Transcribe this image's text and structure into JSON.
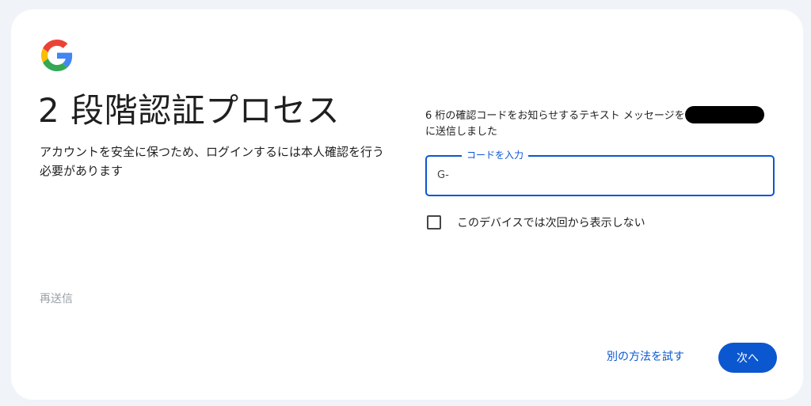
{
  "brand": {
    "logo_icon": "google-g-icon",
    "colors": {
      "blue": "#4285F4",
      "red": "#EA4335",
      "yellow": "#FBBC05",
      "green": "#34A853"
    }
  },
  "header": {
    "title": "2 段階認証プロセス",
    "subtitle": "アカウントを安全に保つため、ログインするには本人確認を行う必要があります"
  },
  "links": {
    "resend": "再送信",
    "try_another": "別の方法を試す"
  },
  "verification": {
    "message_before": "6 桁の確認コードをお知らせするテキスト メッセージを",
    "message_after": "に送信しました",
    "code_label": "コードを入力",
    "code_prefix": "G-",
    "code_value": ""
  },
  "remember": {
    "label": "このデバイスでは次回から表示しない",
    "checked": false
  },
  "actions": {
    "next_label": "次へ"
  },
  "theme": {
    "accent": "#0b57d0",
    "background": "#f0f4f9",
    "card": "#ffffff"
  }
}
